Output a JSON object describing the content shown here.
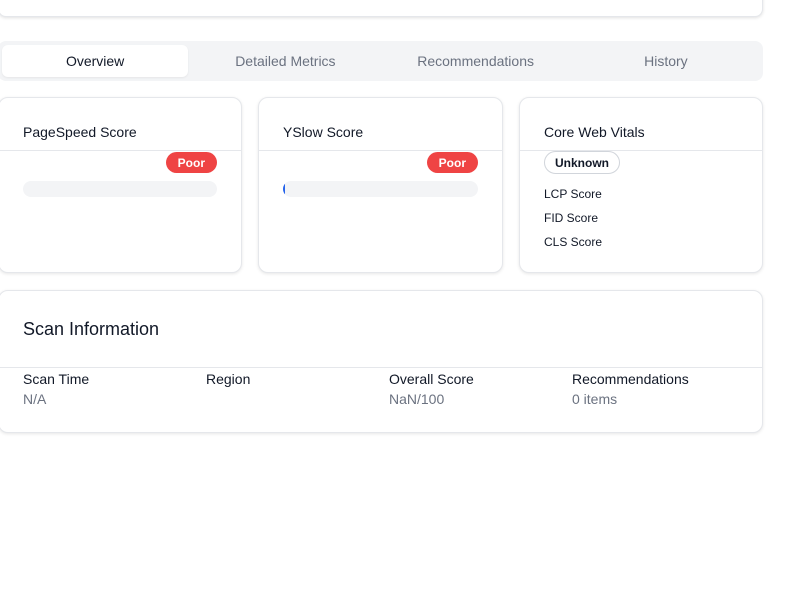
{
  "tabs": [
    {
      "label": "Overview",
      "active": true
    },
    {
      "label": "Detailed Metrics",
      "active": false
    },
    {
      "label": "Recommendations",
      "active": false
    },
    {
      "label": "History",
      "active": false
    }
  ],
  "pagespeed": {
    "title": "PageSpeed Score",
    "badge": "Poor",
    "progress": 0
  },
  "yslow": {
    "title": "YSlow Score",
    "badge": "Poor",
    "progress": 0.01
  },
  "core_web_vitals": {
    "title": "Core Web Vitals",
    "badge": "Unknown",
    "items": [
      "LCP Score",
      "FID Score",
      "CLS Score"
    ]
  },
  "scan_info": {
    "title": "Scan Information",
    "columns": [
      {
        "label": "Scan Time",
        "value": "N/A"
      },
      {
        "label": "Region",
        "value": ""
      },
      {
        "label": "Overall Score",
        "value": "NaN/100"
      },
      {
        "label": "Recommendations",
        "value": "0 items"
      }
    ]
  },
  "colors": {
    "poor": "#ef4444",
    "progress": "#2563eb",
    "tab_bg": "#f3f4f6"
  }
}
